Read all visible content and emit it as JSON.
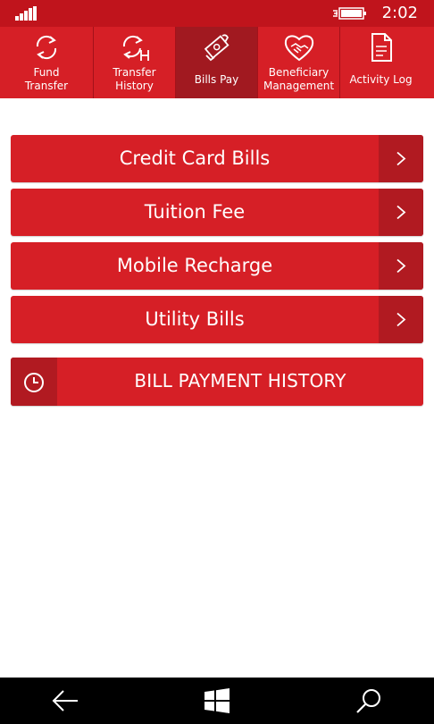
{
  "status_bar": {
    "time": "2:02"
  },
  "tabs": [
    {
      "label": "Fund\nTransfer",
      "icon": "fund-transfer-icon",
      "active": false
    },
    {
      "label": "Transfer\nHistory",
      "icon": "transfer-history-icon",
      "active": false
    },
    {
      "label": "Bills Pay",
      "icon": "bills-pay-icon",
      "active": true
    },
    {
      "label": "Beneficiary\nManagement",
      "icon": "beneficiary-handshake-icon",
      "active": false
    },
    {
      "label": "Activity Log",
      "icon": "activity-log-document-icon",
      "active": false
    }
  ],
  "menu": {
    "items": [
      {
        "label": "Credit Card Bills"
      },
      {
        "label": "Tuition Fee"
      },
      {
        "label": "Mobile Recharge"
      },
      {
        "label": "Utility Bills"
      }
    ],
    "history_button": {
      "label": "BILL PAYMENT HISTORY",
      "icon": "clock-icon"
    }
  },
  "nav_bar": {
    "back": "back-arrow-icon",
    "home": "windows-start-icon",
    "search": "search-icon"
  },
  "colors": {
    "brand_red": "#d61f26",
    "dark_red": "#b11a21",
    "status_red": "#c0141c",
    "active_tab": "#a11920"
  }
}
